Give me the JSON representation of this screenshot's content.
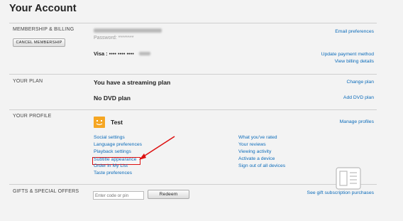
{
  "page_title": "Your Account",
  "membership": {
    "label": "MEMBERSHIP & BILLING",
    "cancel_button": "Cancel Membership",
    "password_label": "Password:",
    "password_mask": "********",
    "visa_label": "Visa :",
    "visa_mask": "•••• •••• ••••",
    "email_link": "Email preferences",
    "update_payment_link": "Update payment method",
    "billing_details_link": "View billing details"
  },
  "plan": {
    "label": "YOUR PLAN",
    "streaming": "You have a streaming plan",
    "dvd": "No DVD plan",
    "change_link": "Change plan",
    "add_dvd_link": "Add DVD plan"
  },
  "profile": {
    "label": "YOUR PROFILE",
    "name": "Test",
    "manage_link": "Manage profiles",
    "left_links": [
      "Social settings",
      "Language preferences",
      "Playback settings",
      "Subtitle appearance",
      "Order in My List",
      "Taste preferences"
    ],
    "right_links": [
      "What you've rated",
      "Your reviews",
      "Viewing activity",
      "Activate a device",
      "Sign out of all devices"
    ]
  },
  "gifts": {
    "label": "GIFTS & SPECIAL OFFERS",
    "placeholder": "Enter code or pin",
    "redeem_button": "Redeem",
    "purchases_link": "See gift subscription purchases"
  },
  "colors": {
    "link": "#0b6bba",
    "highlight": "#dd1111",
    "avatar": "#f5a623"
  }
}
